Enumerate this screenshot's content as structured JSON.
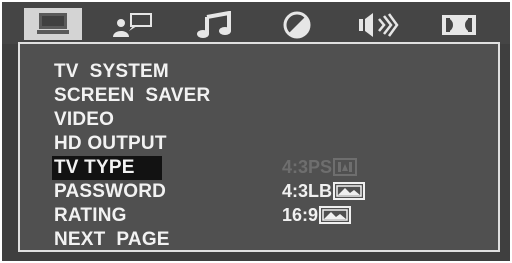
{
  "tabs": [
    {
      "name": "general-setup",
      "icon": "monitor-icon",
      "active": true
    },
    {
      "name": "language-setup",
      "icon": "person-speech-icon",
      "active": false
    },
    {
      "name": "audio-setup",
      "icon": "music-notes-icon",
      "active": false
    },
    {
      "name": "video-setup",
      "icon": "contrast-circle-icon",
      "active": false
    },
    {
      "name": "speaker-setup",
      "icon": "speaker-volume-icon",
      "active": false
    },
    {
      "name": "dolby-setup",
      "icon": "dolby-icon",
      "active": false
    }
  ],
  "menu": {
    "items": [
      {
        "label": "TV  SYSTEM",
        "selected": false
      },
      {
        "label": "SCREEN  SAVER",
        "selected": false
      },
      {
        "label": "VIDEO",
        "selected": false
      },
      {
        "label": "HD OUTPUT",
        "selected": false
      },
      {
        "label": "TV TYPE",
        "selected": true
      },
      {
        "label": "PASSWORD",
        "selected": false
      },
      {
        "label": "RATING",
        "selected": false
      },
      {
        "label": "NEXT  PAGE",
        "selected": false
      }
    ]
  },
  "options": {
    "items": [
      {
        "label": "4:3PS",
        "icon": "pan-scan-icon",
        "dim": true
      },
      {
        "label": "4:3LB",
        "icon": "letterbox-icon",
        "dim": false
      },
      {
        "label": "16:9",
        "icon": "widescreen-icon",
        "dim": false
      }
    ]
  },
  "colors": {
    "background": "#3f3f3f",
    "panel": "#505050",
    "active_tab": "#d4d4d4",
    "selection": "#121212",
    "text": "#f2f2f2",
    "dim_text": "#6e6e6e"
  }
}
